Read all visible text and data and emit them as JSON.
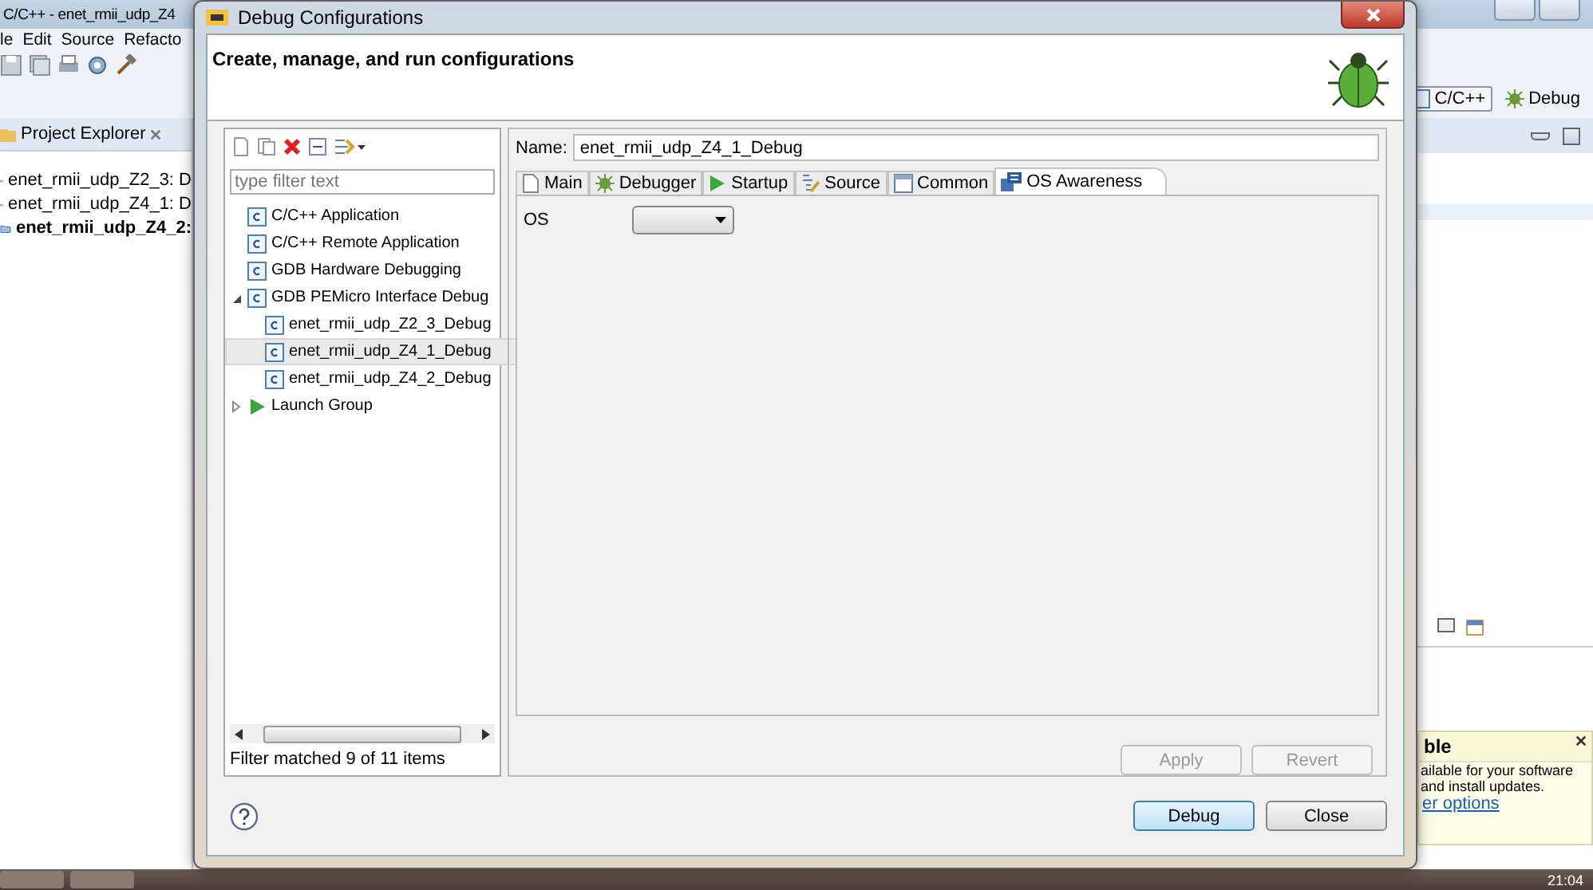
{
  "ide": {
    "title": "C/C++ - enet_rmii_udp_Z4",
    "menu": [
      "le",
      "Edit",
      "Source",
      "Refacto"
    ],
    "perspectives": [
      {
        "label": "C/C++",
        "selected": true
      },
      {
        "label": "Debug",
        "selected": false
      }
    ],
    "project_explorer": {
      "title": "Project Explorer",
      "items": [
        {
          "label": "enet_rmii_udp_Z2_3: D",
          "bold": false
        },
        {
          "label": "enet_rmii_udp_Z4_1: D",
          "bold": false
        },
        {
          "label": "enet_rmii_udp_Z4_2:",
          "bold": true
        }
      ]
    },
    "notification": {
      "title": "ble",
      "lines": [
        "ailable for your software",
        "and install updates."
      ],
      "link": "er options"
    }
  },
  "dialog": {
    "title": "Debug Configurations",
    "header": "Create, manage, and run configurations",
    "filter": {
      "placeholder": "type filter text"
    },
    "tree": [
      {
        "label": "C/C++ Application",
        "kind": "config",
        "selected": false
      },
      {
        "label": "C/C++ Remote Application",
        "kind": "config",
        "selected": false
      },
      {
        "label": "GDB Hardware Debugging",
        "kind": "config",
        "selected": false
      },
      {
        "label": "GDB PEMicro Interface Debug",
        "kind": "config",
        "selected": false,
        "expanded": true,
        "children": [
          {
            "label": "enet_rmii_udp_Z2_3_Debug",
            "kind": "config",
            "selected": false
          },
          {
            "label": "enet_rmii_udp_Z4_1_Debug",
            "kind": "config",
            "selected": true
          },
          {
            "label": "enet_rmii_udp_Z4_2_Debug",
            "kind": "config",
            "selected": false
          }
        ]
      },
      {
        "label": "Launch Group",
        "kind": "launch",
        "selected": false,
        "expanded": false
      }
    ],
    "filter_status": "Filter matched 9 of 11 items",
    "name_label": "Name:",
    "name_value": "enet_rmii_udp_Z4_1_Debug",
    "tabs": [
      {
        "label": "Main",
        "kind": "main",
        "selected": false
      },
      {
        "label": "Debugger",
        "kind": "debugger",
        "selected": false
      },
      {
        "label": "Startup",
        "kind": "startup",
        "selected": false
      },
      {
        "label": "Source",
        "kind": "source",
        "selected": false
      },
      {
        "label": "Common",
        "kind": "common",
        "selected": false
      },
      {
        "label": "OS Awareness",
        "kind": "os",
        "selected": true
      }
    ],
    "os_label": "OS",
    "apply": {
      "label": "Apply",
      "disabled": true
    },
    "revert": {
      "label": "Revert",
      "disabled": true
    },
    "debug": {
      "label": "Debug"
    },
    "close": {
      "label": "Close"
    }
  },
  "taskbar": {
    "clock": "21:04"
  }
}
